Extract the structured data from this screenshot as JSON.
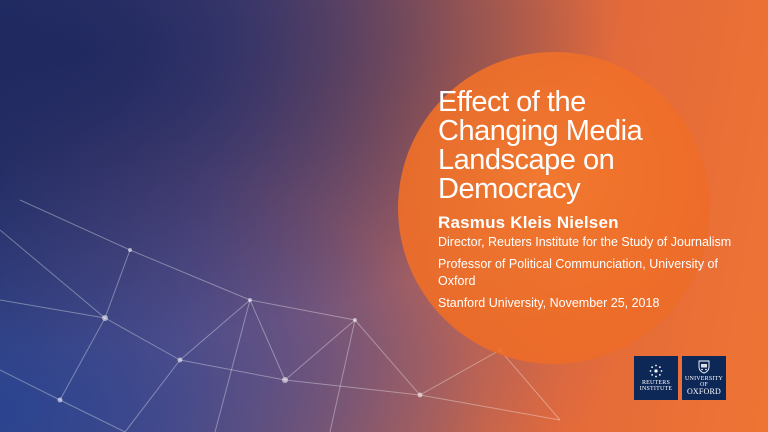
{
  "slide": {
    "title": "Effect of the Changing Media Landscape on Democracy",
    "speaker": {
      "name": "Rasmus Kleis Nielsen",
      "role_1": "Director, Reuters Institute for the Study of Journalism",
      "role_2": "Professor of Political Communciation, University of Oxford",
      "event": "Stanford University, November 25, 2018"
    }
  },
  "logos": {
    "reuters": {
      "line1": "REUTERS",
      "line2": "INSTITUTE",
      "emblem_icon": "star-ring-icon"
    },
    "oxford": {
      "line1": "UNIVERSITY OF",
      "line2": "OXFORD",
      "emblem_icon": "crest-icon"
    }
  },
  "colors": {
    "accent_orange": "#ee6d28",
    "logo_navy": "#0d2756",
    "text": "#ffffff"
  }
}
